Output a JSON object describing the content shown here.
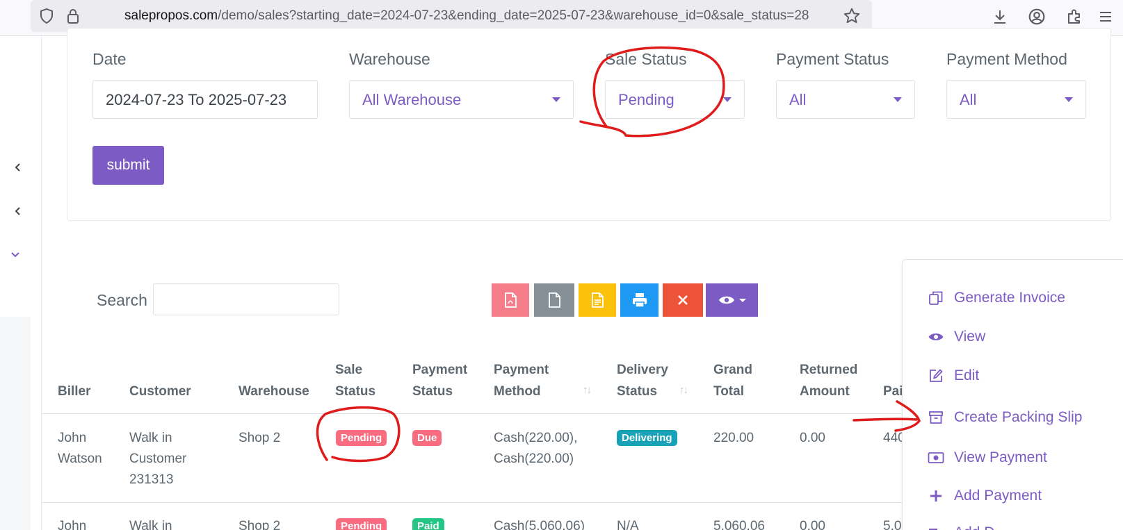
{
  "browser": {
    "url_host": "salepropos.com",
    "url_path": "/demo/sales?starting_date=2024-07-23&ending_date=2025-07-23&warehouse_id=0&sale_status=28"
  },
  "filters": {
    "date_label": "Date",
    "date_value": "2024-07-23 To 2025-07-23",
    "warehouse_label": "Warehouse",
    "warehouse_value": "All Warehouse",
    "sale_status_label": "Sale Status",
    "sale_status_value": "Pending",
    "payment_status_label": "Payment Status",
    "payment_status_value": "All",
    "payment_method_label": "Payment Method",
    "payment_method_value": "All",
    "submit_label": "submit"
  },
  "search": {
    "label": "Search",
    "value": ""
  },
  "table": {
    "headers": {
      "biller": "Biller",
      "customer": "Customer",
      "warehouse": "Warehouse",
      "sale_status_1": "Sale",
      "sale_status_2": "Status",
      "payment_status_1": "Payment",
      "payment_status_2": "Status",
      "payment_method_1": "Payment",
      "payment_method_2": "Method",
      "delivery_status_1": "Delivery",
      "delivery_status_2": "Status",
      "grand_total_1": "Grand",
      "grand_total_2": "Total",
      "returned_amount_1": "Returned",
      "returned_amount_2": "Amount",
      "paid_cut": "Pai"
    },
    "rows": [
      {
        "biller_1": "John",
        "biller_2": "Watson",
        "customer_1": "Walk in",
        "customer_2": "Customer",
        "customer_3": "231313",
        "warehouse": "Shop 2",
        "sale_status": "Pending",
        "payment_status": "Due",
        "payment_method_1": "Cash(220.00),",
        "payment_method_2": "Cash(220.00)",
        "delivery_status": "Delivering",
        "grand_total": "220.00",
        "returned_amount": "0.00",
        "paid_cut": "440"
      },
      {
        "biller_1": "John",
        "customer_1": "Walk in",
        "warehouse": "Shop 2",
        "sale_status": "Pending",
        "payment_status": "Paid",
        "payment_method_1": "Cash(5,060.06)",
        "delivery_status": "N/A",
        "grand_total": "5,060.06",
        "returned_amount": "0.00",
        "paid_cut": "5,0"
      }
    ]
  },
  "actions_menu": {
    "items": [
      {
        "label": "Generate Invoice",
        "icon": "copy-icon"
      },
      {
        "label": "View",
        "icon": "eye-icon"
      },
      {
        "label": "Edit",
        "icon": "edit-icon"
      },
      {
        "label": "Create Packing Slip",
        "icon": "archive-icon"
      },
      {
        "label": "View Payment",
        "icon": "money-icon"
      },
      {
        "label": "Add Payment",
        "icon": "plus-icon"
      },
      {
        "label": "Add D",
        "icon": "truck-icon"
      }
    ]
  },
  "colors": {
    "accent": "#7c5cc4",
    "pending": "#f96b7f",
    "due": "#f96b7f",
    "paid": "#24c585",
    "delivering": "#17a2b8",
    "pdf": "#f67e8b",
    "csv": "#868e96",
    "excel": "#fcc20b",
    "print": "#1e9af5",
    "delete": "#ec5338",
    "annotation": "#e01b1b"
  }
}
